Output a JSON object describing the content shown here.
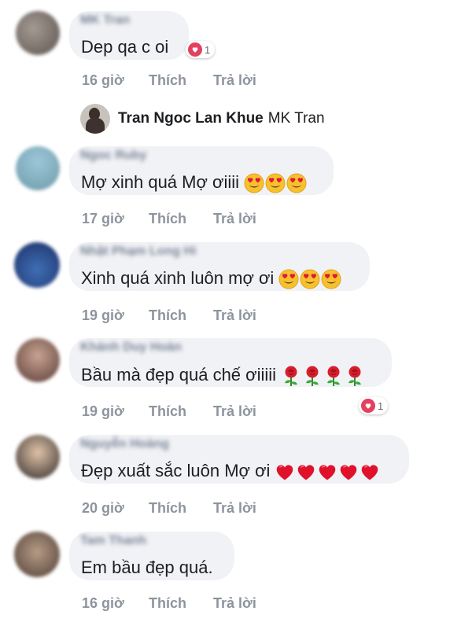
{
  "actions": {
    "like": "Thích",
    "reply": "Trả lời"
  },
  "tag": {
    "name": "Tran Ngoc Lan Khue",
    "mention": "MK Tran"
  },
  "comments": [
    {
      "author": "MK Tran",
      "text": "Dep qa c oi",
      "time": "16 giờ",
      "reaction_count": "1"
    },
    {
      "author": "Ngoc Ruby",
      "text": "Mợ xinh quá Mợ ơiiii",
      "time": "17 giờ",
      "emoji": "heart-eyes-emoji",
      "emoji_count": 3
    },
    {
      "author": "Nhật Phạm Long Hi",
      "text": "Xinh quá xinh luôn mợ ơi",
      "time": "19 giờ",
      "emoji": "heart-eyes-emoji",
      "emoji_count": 3
    },
    {
      "author": "Khánh Duy Hoàn",
      "text": "Bầu mà đẹp quá chế ơiiiii",
      "time": "19 giờ",
      "emoji": "rose-emoji",
      "emoji_count": 4,
      "reaction_count": "1"
    },
    {
      "author": "Nguyễn Hoàng",
      "text": "Đẹp xuất sắc luôn Mợ ơi",
      "time": "20 giờ",
      "emoji": "red-heart-emoji",
      "emoji_count": 5
    },
    {
      "author": "Tam Thanh",
      "text": "Em bầu đẹp quá.",
      "time": "16 giờ"
    }
  ],
  "colors": {
    "bubble": "#f0f2f5",
    "meta": "#8d949e",
    "reaction_heart": "#e4405f"
  }
}
